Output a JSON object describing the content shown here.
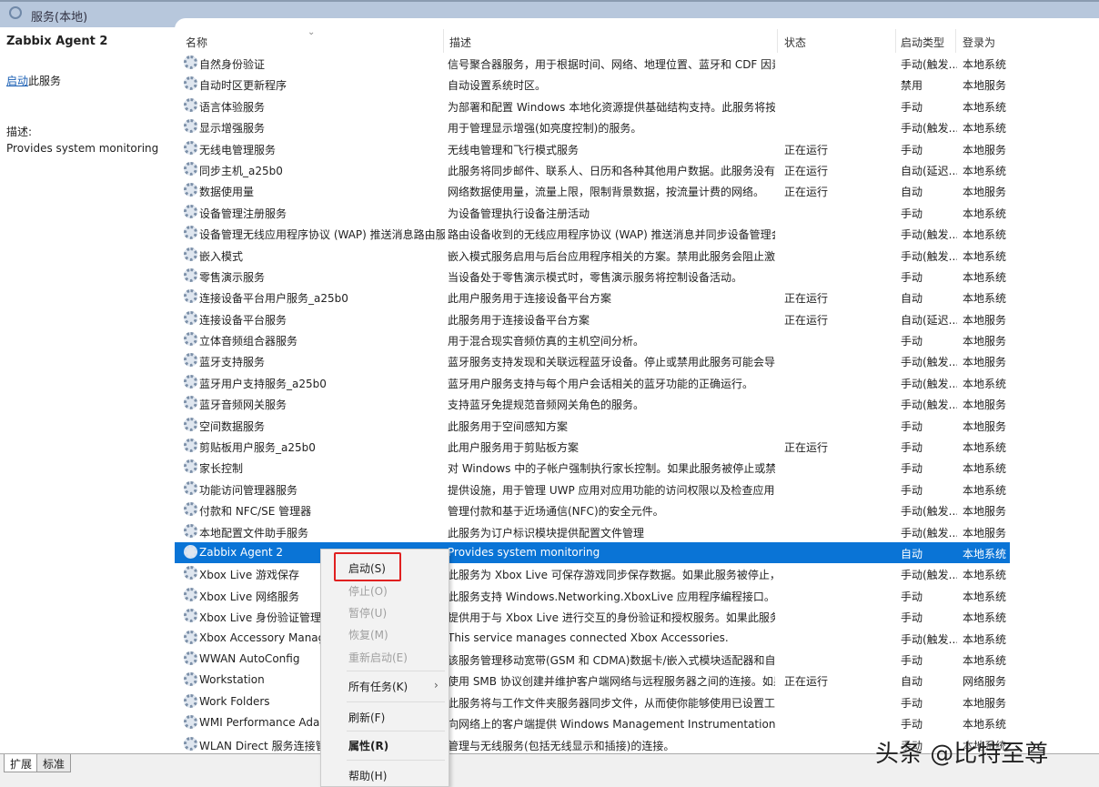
{
  "window": {
    "title": "服务(本地)"
  },
  "left": {
    "service_name": "Zabbix Agent 2",
    "start_link": "启动",
    "start_suffix": "此服务",
    "desc_label": "描述:",
    "desc_value": "Provides system monitoring"
  },
  "columns": {
    "name": "名称",
    "desc": "描述",
    "status": "状态",
    "startup": "启动类型",
    "logon": "登录为"
  },
  "rows": [
    {
      "name": "自然身份验证",
      "desc": "信号聚合器服务，用于根据时间、网络、地理位置、蓝牙和 CDF 因素...",
      "status": "",
      "startup": "手动(触发...",
      "logon": "本地系统"
    },
    {
      "name": "自动时区更新程序",
      "desc": "自动设置系统时区。",
      "status": "",
      "startup": "禁用",
      "logon": "本地服务"
    },
    {
      "name": "语言体验服务",
      "desc": "为部署和配置 Windows 本地化资源提供基础结构支持。此服务将按需...",
      "status": "",
      "startup": "手动",
      "logon": "本地系统"
    },
    {
      "name": "显示增强服务",
      "desc": "用于管理显示增强(如亮度控制)的服务。",
      "status": "",
      "startup": "手动(触发...",
      "logon": "本地系统"
    },
    {
      "name": "无线电管理服务",
      "desc": "无线电管理和飞行模式服务",
      "status": "正在运行",
      "startup": "手动",
      "logon": "本地服务"
    },
    {
      "name": "同步主机_a25b0",
      "desc": "此服务将同步邮件、联系人、日历和各种其他用户数据。此服务没有运...",
      "status": "正在运行",
      "startup": "自动(延迟...",
      "logon": "本地系统"
    },
    {
      "name": "数据使用量",
      "desc": "网络数据使用量，流量上限，限制背景数据，按流量计费的网络。",
      "status": "正在运行",
      "startup": "自动",
      "logon": "本地服务"
    },
    {
      "name": "设备管理注册服务",
      "desc": "为设备管理执行设备注册活动",
      "status": "",
      "startup": "手动",
      "logon": "本地系统"
    },
    {
      "name": "设备管理无线应用程序协议 (WAP) 推送消息路由服务",
      "desc": "路由设备收到的无线应用程序协议 (WAP) 推送消息并同步设备管理会话",
      "status": "",
      "startup": "手动(触发...",
      "logon": "本地系统"
    },
    {
      "name": "嵌入模式",
      "desc": "嵌入模式服务启用与后台应用程序相关的方案。禁用此服务会阻止激活...",
      "status": "",
      "startup": "手动(触发...",
      "logon": "本地系统"
    },
    {
      "name": "零售演示服务",
      "desc": "当设备处于零售演示模式时，零售演示服务将控制设备活动。",
      "status": "",
      "startup": "手动",
      "logon": "本地系统"
    },
    {
      "name": "连接设备平台用户服务_a25b0",
      "desc": "此用户服务用于连接设备平台方案",
      "status": "正在运行",
      "startup": "自动",
      "logon": "本地系统"
    },
    {
      "name": "连接设备平台服务",
      "desc": "此服务用于连接设备平台方案",
      "status": "正在运行",
      "startup": "自动(延迟...",
      "logon": "本地服务"
    },
    {
      "name": "立体音频组合器服务",
      "desc": "用于混合现实音频仿真的主机空间分析。",
      "status": "",
      "startup": "手动",
      "logon": "本地服务"
    },
    {
      "name": "蓝牙支持服务",
      "desc": "蓝牙服务支持发现和关联远程蓝牙设备。停止或禁用此服务可能会导致...",
      "status": "",
      "startup": "手动(触发...",
      "logon": "本地服务"
    },
    {
      "name": "蓝牙用户支持服务_a25b0",
      "desc": "蓝牙用户服务支持与每个用户会话相关的蓝牙功能的正确运行。",
      "status": "",
      "startup": "手动(触发...",
      "logon": "本地系统"
    },
    {
      "name": "蓝牙音频网关服务",
      "desc": "支持蓝牙免提规范音频网关角色的服务。",
      "status": "",
      "startup": "手动(触发...",
      "logon": "本地服务"
    },
    {
      "name": "空间数据服务",
      "desc": "此服务用于空间感知方案",
      "status": "",
      "startup": "手动",
      "logon": "本地服务"
    },
    {
      "name": "剪贴板用户服务_a25b0",
      "desc": "此用户服务用于剪贴板方案",
      "status": "正在运行",
      "startup": "手动",
      "logon": "本地系统"
    },
    {
      "name": "家长控制",
      "desc": "对 Windows 中的子帐户强制执行家长控制。如果此服务被停止或禁用...",
      "status": "",
      "startup": "手动",
      "logon": "本地系统"
    },
    {
      "name": "功能访问管理器服务",
      "desc": "提供设施，用于管理 UWP 应用对应用功能的访问权限以及检查应用的...",
      "status": "",
      "startup": "手动",
      "logon": "本地系统"
    },
    {
      "name": "付款和 NFC/SE 管理器",
      "desc": "管理付款和基于近场通信(NFC)的安全元件。",
      "status": "",
      "startup": "手动(触发...",
      "logon": "本地服务"
    },
    {
      "name": "本地配置文件助手服务",
      "desc": "此服务为订户标识模块提供配置文件管理",
      "status": "",
      "startup": "手动(触发...",
      "logon": "本地服务"
    },
    {
      "name": "Zabbix Agent 2",
      "desc": "Provides system monitoring",
      "status": "",
      "startup": "自动",
      "logon": "本地系统",
      "selected": true
    },
    {
      "name": "Xbox Live 游戏保存",
      "desc": "此服务为 Xbox Live 可保存游戏同步保存数据。如果此服务被停止，游...",
      "status": "",
      "startup": "手动(触发...",
      "logon": "本地系统"
    },
    {
      "name": "Xbox Live 网络服务",
      "desc": "此服务支持 Windows.Networking.XboxLive 应用程序编程接口。",
      "status": "",
      "startup": "手动",
      "logon": "本地系统"
    },
    {
      "name": "Xbox Live 身份验证管理器",
      "desc": "提供用于与 Xbox Live 进行交互的身份验证和授权服务。如果此服务被...",
      "status": "",
      "startup": "手动",
      "logon": "本地系统"
    },
    {
      "name": "Xbox Accessory Management Service",
      "desc": "This service manages connected Xbox Accessories.",
      "status": "",
      "startup": "手动(触发...",
      "logon": "本地系统"
    },
    {
      "name": "WWAN AutoConfig",
      "desc": "该服务管理移动宽带(GSM 和 CDMA)数据卡/嵌入式模块适配器和自动...",
      "status": "",
      "startup": "手动",
      "logon": "本地系统"
    },
    {
      "name": "Workstation",
      "desc": "使用 SMB 协议创建并维护客户端网络与远程服务器之间的连接。如果...",
      "status": "正在运行",
      "startup": "自动",
      "logon": "网络服务"
    },
    {
      "name": "Work Folders",
      "desc": "此服务将与工作文件夹服务器同步文件，从而使你能够使用已设置工作...",
      "status": "",
      "startup": "手动",
      "logon": "本地服务"
    },
    {
      "name": "WMI Performance Adapter",
      "desc": "向网络上的客户端提供 Windows Management Instrumentation (W...",
      "status": "",
      "startup": "手动",
      "logon": "本地系统"
    },
    {
      "name": "WLAN Direct 服务连接管理器服务",
      "desc": "管理与无线服务(包括无线显示和插接)的连接。",
      "status": "",
      "startup": "手动",
      "logon": "本地系统"
    }
  ],
  "context_menu": {
    "start": "启动(S)",
    "stop": "停止(O)",
    "pause": "暂停(U)",
    "resume": "恢复(M)",
    "restart": "重新启动(E)",
    "all_tasks": "所有任务(K)",
    "refresh": "刷新(F)",
    "properties": "属性(R)",
    "help": "帮助(H)"
  },
  "tabs": {
    "extended": "扩展",
    "standard": "标准"
  },
  "watermark": "头条 @比特至尊",
  "colors": {
    "selection": "#0a74d6",
    "highlight_box": "#e02020"
  }
}
